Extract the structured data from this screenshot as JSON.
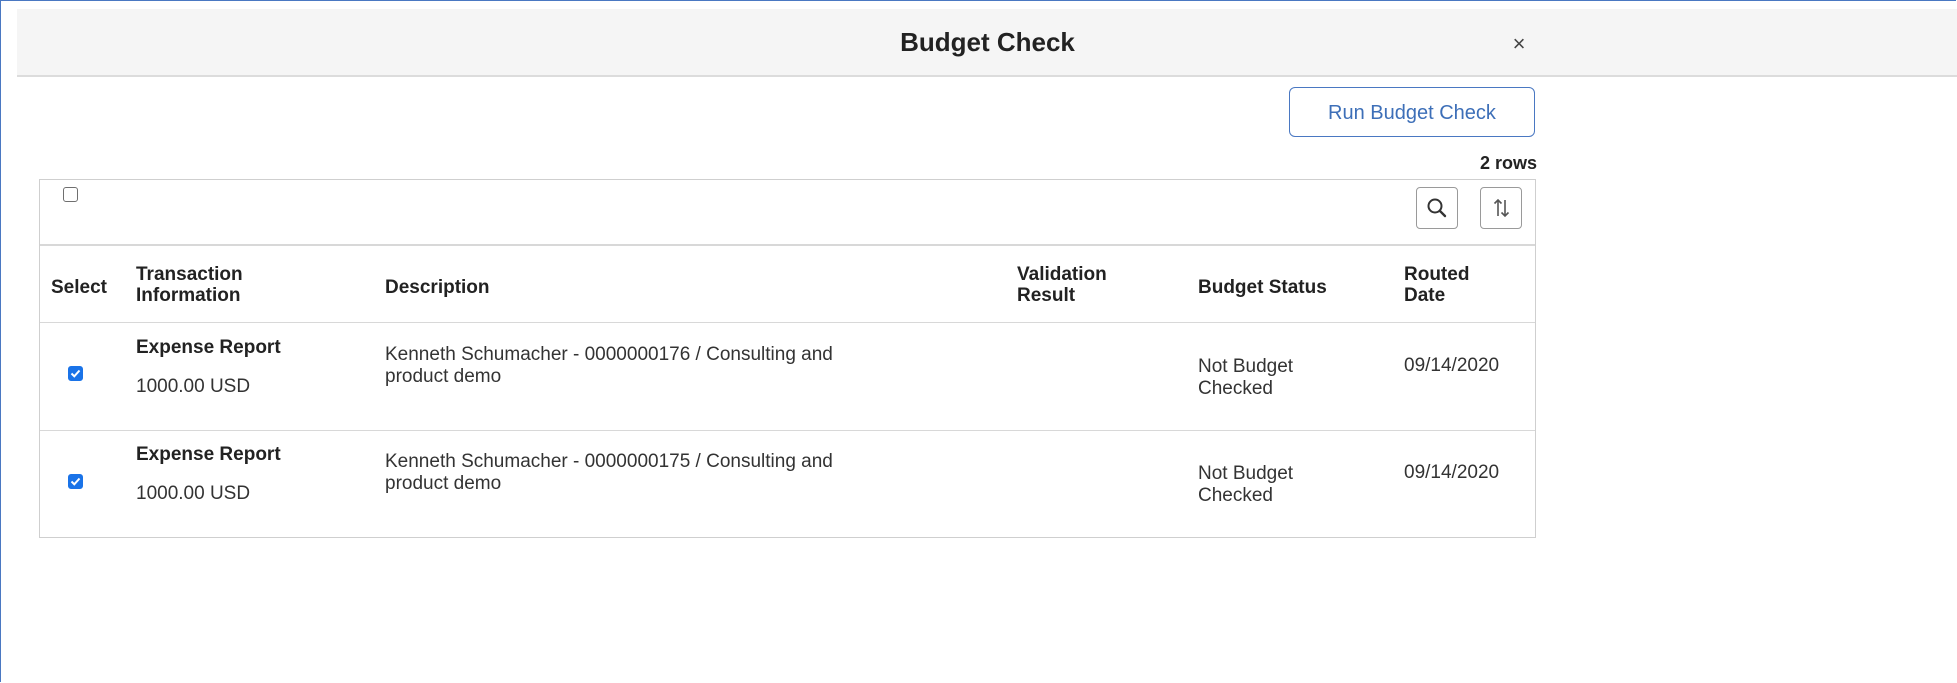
{
  "dialog": {
    "title": "Budget Check",
    "close_glyph": "×",
    "run_button_label": "Run Budget Check",
    "rows_count": "2 rows"
  },
  "table": {
    "columns": [
      "Select",
      "Transaction Information",
      "Description",
      "Validation Result",
      "Budget Status",
      "Routed Date"
    ],
    "header_lines": {
      "select": "Select",
      "transaction_1": "Transaction",
      "transaction_2": "Information",
      "description": "Description",
      "validation_1": "Validation",
      "validation_2": "Result",
      "budget_status": "Budget Status",
      "routed_1": "Routed",
      "routed_2": "Date"
    },
    "rows": [
      {
        "selected": true,
        "transaction_type": "Expense Report",
        "amount": "1000.00 USD",
        "description_line1": "Kenneth Schumacher - 0000000176 / Consulting and",
        "description_line2": "product demo",
        "validation_result": "",
        "budget_status_line1": "Not Budget",
        "budget_status_line2": "Checked",
        "routed_date": "09/14/2020"
      },
      {
        "selected": true,
        "transaction_type": "Expense Report",
        "amount": "1000.00 USD",
        "description_line1": "Kenneth Schumacher - 0000000175 / Consulting and",
        "description_line2": "product demo",
        "validation_result": "",
        "budget_status_line1": "Not Budget",
        "budget_status_line2": "Checked",
        "routed_date": "09/14/2020"
      }
    ]
  },
  "icons": {
    "search": "search-icon",
    "sort": "sort-icon",
    "close": "close-icon"
  },
  "colors": {
    "accent": "#1a73e8",
    "button_text": "#3d6fb8",
    "modal_border": "#4a78c2"
  }
}
